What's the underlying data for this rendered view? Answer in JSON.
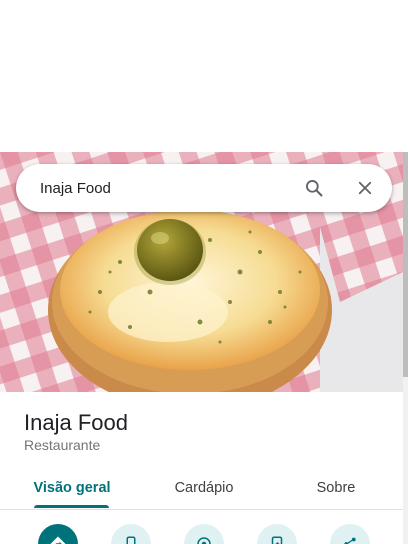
{
  "search": {
    "value": "Inaja Food"
  },
  "place": {
    "name": "Inaja Food",
    "category": "Restaurante"
  },
  "tabs": [
    {
      "label": "Visão geral",
      "active": true
    },
    {
      "label": "Cardápio",
      "active": false
    },
    {
      "label": "Sobre",
      "active": false
    }
  ],
  "actions": [
    {
      "icon": "directions-icon"
    },
    {
      "icon": "phone-icon"
    },
    {
      "icon": "nearby-icon"
    },
    {
      "icon": "send-to-phone-icon"
    },
    {
      "icon": "share-icon"
    }
  ],
  "colors": {
    "accent": "#00737a",
    "accent_light": "#dff1f2",
    "text": "#202124",
    "muted": "#70757a"
  }
}
